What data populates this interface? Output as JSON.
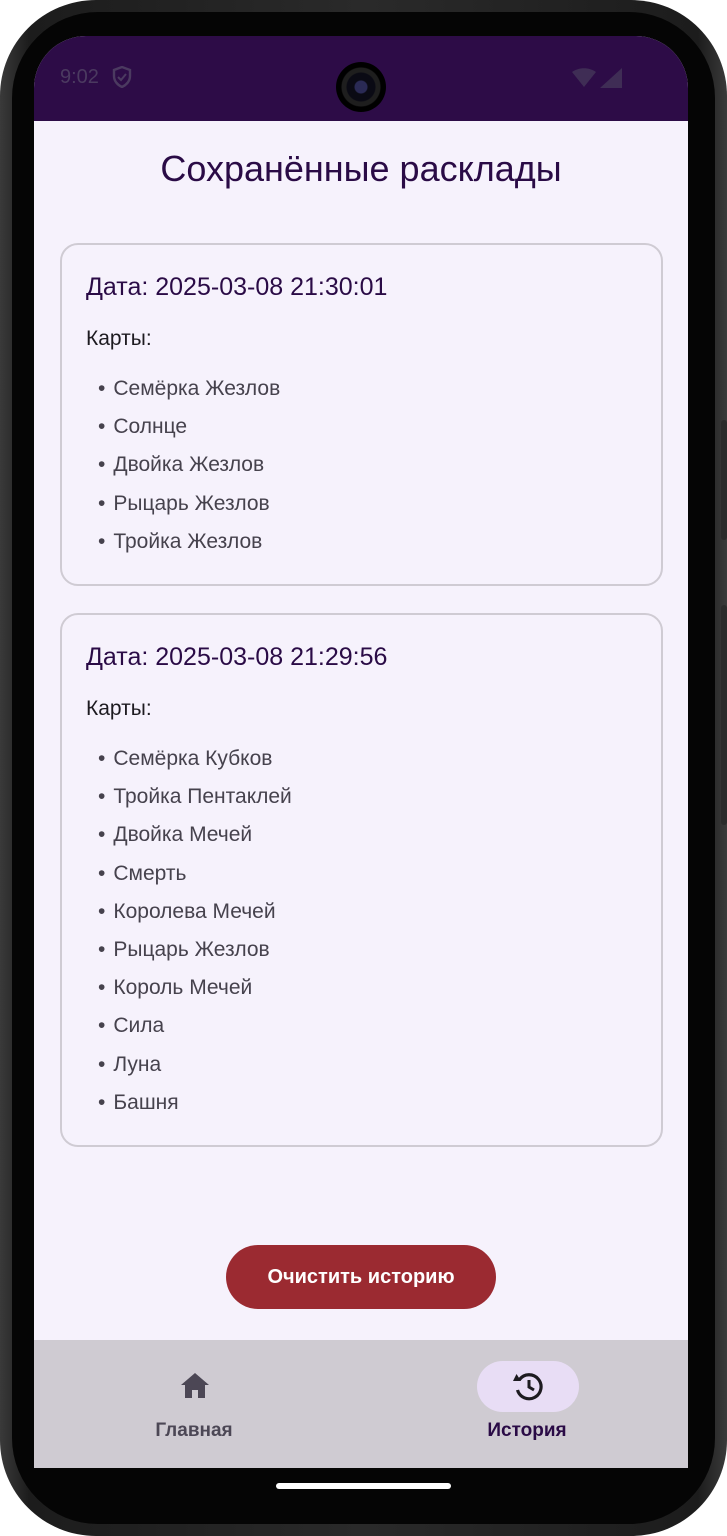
{
  "status_bar": {
    "time": "9:02",
    "icons": [
      "shield-icon",
      "wifi-icon",
      "signal-icon"
    ]
  },
  "page": {
    "title": "Сохранённые расклады"
  },
  "history": {
    "cards_label": "Карты:",
    "bullet": "•",
    "entries": [
      {
        "date": "Дата: 2025-03-08 21:30:01",
        "cards": [
          "Семёрка Жезлов",
          "Солнце",
          "Двойка Жезлов",
          "Рыцарь Жезлов",
          "Тройка Жезлов"
        ]
      },
      {
        "date": "Дата: 2025-03-08 21:29:56",
        "cards": [
          "Семёрка Кубков",
          "Тройка Пентаклей",
          "Двойка Мечей",
          "Смерть",
          "Королева Мечей",
          "Рыцарь Жезлов",
          "Король Мечей",
          "Сила",
          "Луна",
          "Башня"
        ]
      }
    ]
  },
  "actions": {
    "clear_history_label": "Очистить историю"
  },
  "bottom_nav": {
    "items": [
      {
        "label": "Главная",
        "icon": "home-icon",
        "selected": false
      },
      {
        "label": "История",
        "icon": "history-icon",
        "selected": true
      }
    ]
  },
  "colors": {
    "status_bar_bg": "#2d0c47",
    "screen_bg": "#f6f2fc",
    "title_text": "#2a0b46",
    "clear_button": "#9b2a31",
    "nav_bg": "#cfcbd2",
    "nav_indicator": "#e8ddf5"
  }
}
